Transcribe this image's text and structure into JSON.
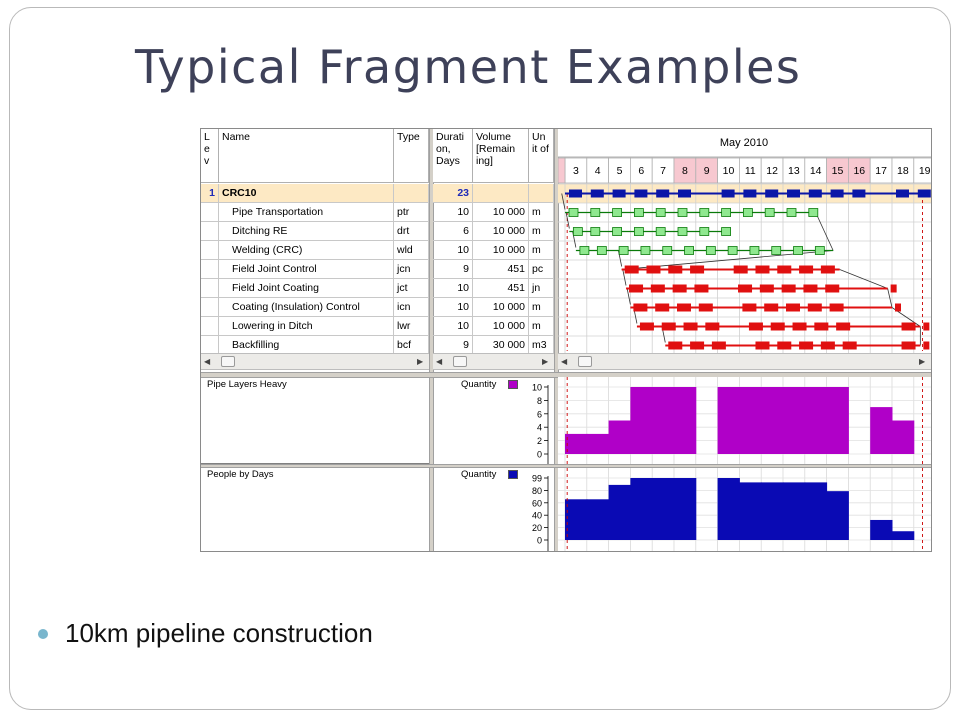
{
  "slide": {
    "title": "Typical Fragment Examples",
    "bullet": "10km pipeline construction"
  },
  "grid": {
    "headers": {
      "lev": "L e v",
      "name": "Name",
      "type": "Type",
      "duration": "Durati on, Days",
      "volume": "Volume [Remain ing]",
      "unit": "Un it of"
    },
    "rows": [
      {
        "lev": "1",
        "name": "CRC10",
        "type": "",
        "duration": "23",
        "volume": "",
        "unit": "",
        "summary": true
      },
      {
        "lev": "",
        "name": "Pipe Transportation",
        "type": "ptr",
        "duration": "10",
        "volume": "10 000",
        "unit": "m"
      },
      {
        "lev": "",
        "name": "Ditching RE",
        "type": "drt",
        "duration": "6",
        "volume": "10 000",
        "unit": "m"
      },
      {
        "lev": "",
        "name": "Welding (CRC)",
        "type": "wld",
        "duration": "10",
        "volume": "10 000",
        "unit": "m"
      },
      {
        "lev": "",
        "name": "Field Joint Control",
        "type": "jcn",
        "duration": "9",
        "volume": "451",
        "unit": "pc"
      },
      {
        "lev": "",
        "name": "Field Joint Coating",
        "type": "jct",
        "duration": "10",
        "volume": "451",
        "unit": "jn"
      },
      {
        "lev": "",
        "name": "Coating (Insulation) Control",
        "type": "icn",
        "duration": "10",
        "volume": "10 000",
        "unit": "m"
      },
      {
        "lev": "",
        "name": "Lowering in Ditch",
        "type": "lwr",
        "duration": "10",
        "volume": "10 000",
        "unit": "m"
      },
      {
        "lev": "",
        "name": "Backfilling",
        "type": "bcf",
        "duration": "9",
        "volume": "30 000",
        "unit": "m3"
      }
    ]
  },
  "timeline": {
    "month": "May 2010",
    "days": [
      "3",
      "4",
      "5",
      "6",
      "7",
      "8",
      "9",
      "10",
      "11",
      "12",
      "13",
      "14",
      "15",
      "16",
      "17",
      "18",
      "19"
    ],
    "weekend_days": [
      "8",
      "9",
      "15",
      "16"
    ]
  },
  "gantt": {
    "bars": [
      {
        "row": 0,
        "start": 0,
        "end": 16.5,
        "kind": "summary",
        "markers": [
          0,
          1,
          2,
          3,
          4,
          5,
          7,
          8,
          9,
          10,
          11,
          12,
          13,
          15,
          16
        ]
      },
      {
        "row": 1,
        "start": 0,
        "end": 11.5,
        "kind": "green",
        "markers": [
          0,
          1,
          2,
          3,
          4,
          5,
          6,
          7,
          8,
          9,
          10,
          11
        ]
      },
      {
        "row": 2,
        "start": 0.2,
        "end": 7.5,
        "kind": "green",
        "markers": [
          0.2,
          1,
          2,
          3,
          4,
          5,
          6,
          7
        ]
      },
      {
        "row": 3,
        "start": 0.5,
        "end": 12.3,
        "kind": "green",
        "markers": [
          0.5,
          1.3,
          2.3,
          3.3,
          4.3,
          5.3,
          6.3,
          7.3,
          8.3,
          9.3,
          10.3,
          11.3
        ]
      },
      {
        "row": 4,
        "start": 2.6,
        "end": 12.6,
        "kind": "red",
        "markers": [
          2.6,
          3.6,
          4.6,
          5.6,
          7.6,
          8.6,
          9.6,
          10.6,
          11.6
        ]
      },
      {
        "row": 5,
        "start": 2.8,
        "end": 14.8,
        "kind": "red",
        "markers": [
          2.8,
          3.8,
          4.8,
          5.8,
          7.8,
          8.8,
          9.8,
          10.8,
          11.8,
          14.8
        ]
      },
      {
        "row": 6,
        "start": 3.0,
        "end": 15.0,
        "kind": "red",
        "markers": [
          3.0,
          4.0,
          5.0,
          6.0,
          8.0,
          9.0,
          10.0,
          11.0,
          12.0,
          15.0
        ]
      },
      {
        "row": 7,
        "start": 3.3,
        "end": 16.3,
        "kind": "red",
        "markers": [
          3.3,
          4.3,
          5.3,
          6.3,
          8.3,
          9.3,
          10.3,
          11.3,
          12.3,
          15.3,
          16.3
        ]
      },
      {
        "row": 8,
        "start": 4.6,
        "end": 16.3,
        "kind": "red",
        "markers": [
          4.6,
          5.6,
          6.6,
          8.6,
          9.6,
          10.6,
          11.6,
          12.6,
          15.3,
          16.3
        ]
      }
    ],
    "colors": {
      "summary": "#0b16a8",
      "green_fill": "#8fe88f",
      "green_line": "#0a7a0a",
      "red": "#e01010",
      "milestone_line": "#333333"
    }
  },
  "resources": [
    {
      "name": "Pipe Layers Heavy",
      "legend": "Quantity",
      "color": "#b000c8",
      "ticks": [
        "10",
        "8",
        "6",
        "4",
        "2",
        "0"
      ],
      "ymax": 10,
      "values": [
        3,
        3,
        5,
        10,
        10,
        10,
        0,
        10,
        10,
        10,
        10,
        10,
        10,
        0,
        7,
        5,
        0
      ]
    },
    {
      "name": "People by Days",
      "legend": "Quantity",
      "color": "#0a0ab4",
      "ticks": [
        "99",
        "80",
        "60",
        "40",
        "20",
        "0"
      ],
      "ymax": 99,
      "values": [
        65,
        65,
        88,
        99,
        99,
        99,
        0,
        99,
        92,
        92,
        92,
        92,
        78,
        0,
        32,
        14,
        0
      ]
    }
  ],
  "colors": {
    "weekend_header": "#f7c8d0",
    "selected_row": "#fde9c4",
    "grid_line": "#d0d0d0"
  }
}
